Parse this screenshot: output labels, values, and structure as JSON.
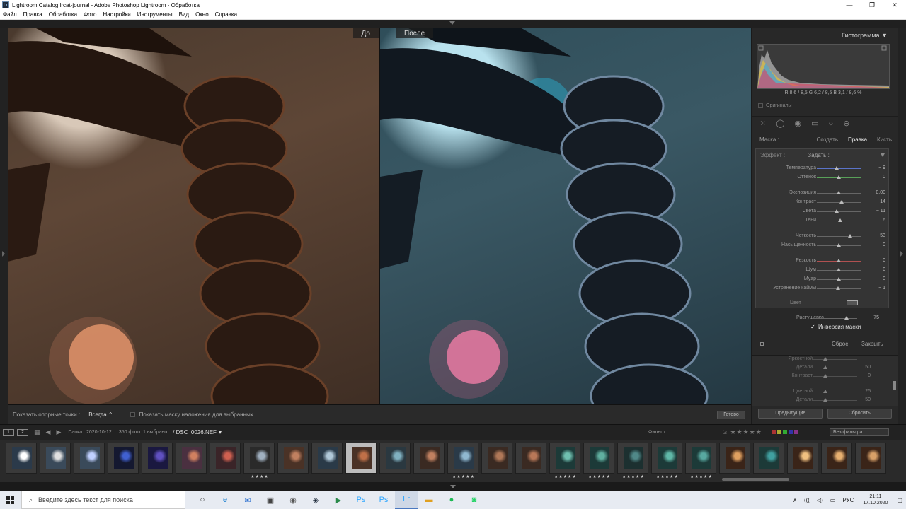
{
  "window": {
    "title": "Lightroom Catalog.lrcat-journal - Adobe Photoshop Lightroom - Обработка",
    "app_icon": "Lr",
    "minimize": "—",
    "maximize": "❐",
    "close": "✕"
  },
  "menu": [
    "Файл",
    "Правка",
    "Обработка",
    "Фото",
    "Настройки",
    "Инструменты",
    "Вид",
    "Окно",
    "Справка"
  ],
  "labels": {
    "before": "До",
    "after": "После"
  },
  "toolbar": {
    "show_pins": "Показать опорные точки :",
    "pins_value": "Всегда",
    "pins_arrow": "⌃",
    "show_overlay": "Показать маску наложения для выбранных",
    "done": "Готово"
  },
  "histogram": {
    "title": "Гистограмма",
    "arrow": "▼",
    "rgb": "R  8,6 / 8,5  G  6,2 / 8,5  B  3,1 / 8,6 %",
    "originals": "Оригиналы"
  },
  "tools": [
    "⁙",
    "◯",
    "◉",
    "▭",
    "○",
    "⊖"
  ],
  "mask": {
    "label": "Маска :",
    "create": "Создать",
    "edit": "Правка",
    "brush": "Кисть"
  },
  "effect": {
    "label": "Эффект :",
    "value": "Задать :"
  },
  "sliders": [
    {
      "label": "Температура",
      "value": "− 9",
      "pos": 0.45,
      "color": "#5a73c9"
    },
    {
      "label": "Оттенок",
      "value": "0",
      "pos": 0.5,
      "color": "#58a058"
    },
    {
      "label": "Экспозиция",
      "value": "0,00",
      "pos": 0.5,
      "color": "#666666"
    },
    {
      "label": "Контраст",
      "value": "14",
      "pos": 0.57,
      "color": "#666666"
    },
    {
      "label": "Света",
      "value": "− 11",
      "pos": 0.45,
      "color": "#666666"
    },
    {
      "label": "Тени",
      "value": "6",
      "pos": 0.53,
      "color": "#666666"
    },
    {
      "label": "Четкость",
      "value": "53",
      "pos": 0.76,
      "color": "#666666"
    },
    {
      "label": "Насыщенность",
      "value": "0",
      "pos": 0.5,
      "color": "#666666"
    },
    {
      "label": "Резкость",
      "value": "0",
      "pos": 0.5,
      "color": "#b05050"
    },
    {
      "label": "Шум",
      "value": "0",
      "pos": 0.5,
      "color": "#666666"
    },
    {
      "label": "Муар",
      "value": "0",
      "pos": 0.5,
      "color": "#666666"
    },
    {
      "label": "Устранение каймы",
      "value": "− 1",
      "pos": 0.49,
      "color": "#666666"
    }
  ],
  "color_label": "Цвет",
  "feather": {
    "label": "Растушевка",
    "value": "75",
    "pos": 0.75
  },
  "invert": {
    "check": "✓",
    "label": "Инверсия маски"
  },
  "reset": "Сброс",
  "close": "Закрыть",
  "under_panel": {
    "rows": [
      {
        "label": "Яркостной",
        "value": ""
      },
      {
        "label": "Детали",
        "value": "50"
      },
      {
        "label": "Контраст",
        "value": "0"
      },
      {
        "label": "Цветной",
        "value": "25"
      },
      {
        "label": "Детали",
        "value": "50"
      }
    ]
  },
  "buttons": {
    "prev": "Предыдущие",
    "reset_all": "Сбросить"
  },
  "filmbar": {
    "view1": "1",
    "view2": "2",
    "folder": "Папка : 2020-10-12",
    "count": "350 фото",
    "selected": "1 выбрано",
    "file": "/ DSC_0026.NEF",
    "file_arrow": "▾",
    "filter_label": "Фильтр :",
    "stars": "≥ ★★★★★",
    "no_filter": "Без фильтра"
  },
  "thumbs": [
    {
      "c1": "#2b3a4a",
      "c2": "#ffffff",
      "stars": ""
    },
    {
      "c1": "#3a4a5a",
      "c2": "#e0e0e0",
      "stars": ""
    },
    {
      "c1": "#3a4a5a",
      "c2": "#c0d0ff",
      "stars": ""
    },
    {
      "c1": "#141830",
      "c2": "#4060d0",
      "stars": ""
    },
    {
      "c1": "#1a1840",
      "c2": "#6050c0",
      "stars": ""
    },
    {
      "c1": "#4a3040",
      "c2": "#d08060",
      "stars": ""
    },
    {
      "c1": "#3a2428",
      "c2": "#d06050",
      "stars": ""
    },
    {
      "c1": "#2a2a2a",
      "c2": "#a0b0c0",
      "stars": "★★★★"
    },
    {
      "c1": "#4a3226",
      "c2": "#c08060",
      "stars": ""
    },
    {
      "c1": "#2a3a48",
      "c2": "#b0c8d8",
      "stars": ""
    },
    {
      "c1": "#4a3226",
      "c2": "#c07048",
      "stars": ""
    },
    {
      "c1": "#2a3840",
      "c2": "#80b0c0",
      "stars": ""
    },
    {
      "c1": "#3a2a22",
      "c2": "#c08060",
      "stars": ""
    },
    {
      "c1": "#2a3a48",
      "c2": "#90b8d0",
      "stars": "★★★★★"
    },
    {
      "c1": "#3a2a22",
      "c2": "#b07858",
      "stars": ""
    },
    {
      "c1": "#3a2a22",
      "c2": "#b87858",
      "stars": ""
    },
    {
      "c1": "#1c3a38",
      "c2": "#70c0b0",
      "stars": "★★★★★"
    },
    {
      "c1": "#1c3a38",
      "c2": "#60b0a0",
      "stars": "★★★★★"
    },
    {
      "c1": "#1c3030",
      "c2": "#508888",
      "stars": "★★★★★"
    },
    {
      "c1": "#1c3a38",
      "c2": "#60b8a8",
      "stars": "★★★★★"
    },
    {
      "c1": "#1c3a38",
      "c2": "#58a8a0",
      "stars": "★★★★★"
    },
    {
      "c1": "#3a2418",
      "c2": "#e0a060",
      "stars": ""
    },
    {
      "c1": "#1c3a38",
      "c2": "#40a0a0",
      "stars": ""
    },
    {
      "c1": "#3a2418",
      "c2": "#f0c080",
      "stars": ""
    },
    {
      "c1": "#3a2418",
      "c2": "#e8b070",
      "stars": ""
    },
    {
      "c1": "#3a2418",
      "c2": "#d8a068",
      "stars": ""
    }
  ],
  "taskbar": {
    "search_placeholder": "Введите здесь текст для поиска",
    "apps": [
      "○",
      "e",
      "✉",
      "▣",
      "◉",
      "◈",
      "▶",
      "Ps",
      "Ps",
      "Lr",
      "▬",
      "●",
      "◙"
    ],
    "lang": "РУС",
    "time": "21:11",
    "date": "17.10.2020",
    "tray_up": "∧",
    "wifi": "(((",
    "vol": "◁)",
    "batt": "▭",
    "notif": "▢"
  }
}
